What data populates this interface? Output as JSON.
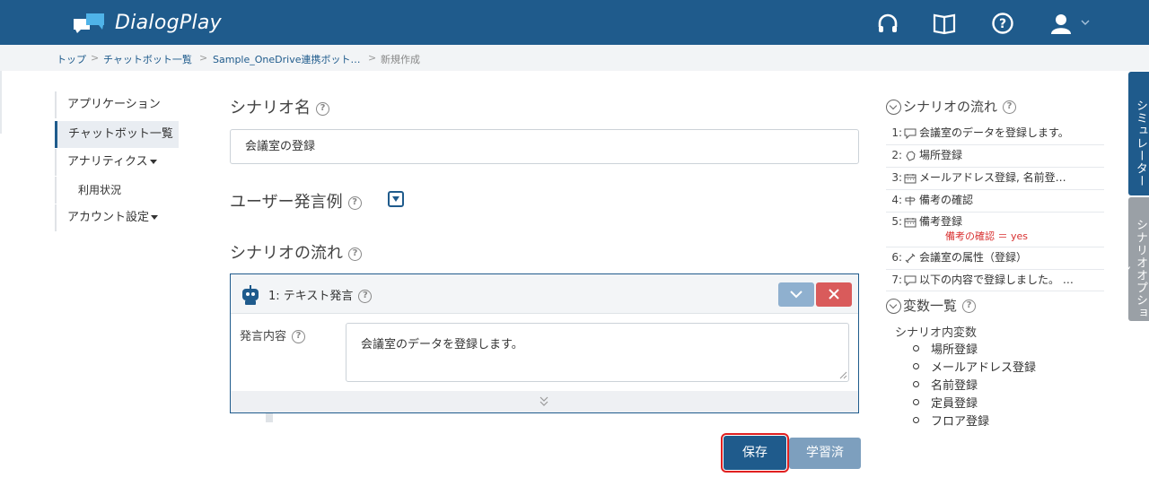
{
  "app": {
    "name": "DialogPlay"
  },
  "header": {
    "icons": [
      "headset-icon",
      "book-icon",
      "help-icon",
      "user-icon",
      "chevron-down-icon"
    ]
  },
  "breadcrumb": [
    {
      "label": "トップ"
    },
    {
      "label": "チャットボット一覧"
    },
    {
      "label": "Sample_OneDrive連携ボット…"
    },
    {
      "label": "新規作成"
    }
  ],
  "breadcrumb_sep": ">",
  "sidebar": {
    "items": [
      {
        "label": "アプリケーション"
      },
      {
        "label": "チャットボット一覧"
      },
      {
        "label": "アナリティクス"
      },
      {
        "label": "利用状況"
      },
      {
        "label": "アカウント設定"
      }
    ]
  },
  "main": {
    "scenario_name_label": "シナリオ名",
    "scenario_name_value": "会議室の登録",
    "utterance_label": "ユーザー発言例",
    "flow_label": "シナリオの流れ",
    "card": {
      "title": "1: テキスト発言",
      "content_label": "発言内容",
      "content_value": "会議室のデータを登録します。"
    },
    "save_label": "保存",
    "learned_label": "学習済"
  },
  "right_panel": {
    "flow_title": "シナリオの流れ",
    "flow_items": [
      {
        "num": "1:",
        "text": "会議室のデータを登録します。",
        "icon": "chat-bubble-icon"
      },
      {
        "num": "2:",
        "text": "場所登録",
        "icon": "hand-icon"
      },
      {
        "num": "3:",
        "text": "メールアドレス登録, 名前登…",
        "icon": "calendar-icon"
      },
      {
        "num": "4:",
        "text": "備考の確認",
        "icon": "signpost-icon"
      },
      {
        "num": "5:",
        "text": "備考登録",
        "icon": "calendar-icon",
        "condition": "備考の確認 ＝ yes"
      },
      {
        "num": "6:",
        "text": "会議室の属性（登録）",
        "icon": "link-icon"
      },
      {
        "num": "7:",
        "text": "以下の内容で登録しました。 …",
        "icon": "chat-bubble-icon"
      }
    ],
    "vars_title": "変数一覧",
    "vars_group": "シナリオ内変数",
    "vars": [
      "場所登録",
      "メールアドレス登録",
      "名前登録",
      "定員登録",
      "フロア登録"
    ]
  },
  "side_tabs": {
    "simulator": "シミュレーター",
    "options": "シナリオオプション"
  },
  "colors": {
    "header": "#1f5b8c",
    "accent": "#1f5b8c",
    "danger": "#d95b5b",
    "condition": "#d83030"
  }
}
